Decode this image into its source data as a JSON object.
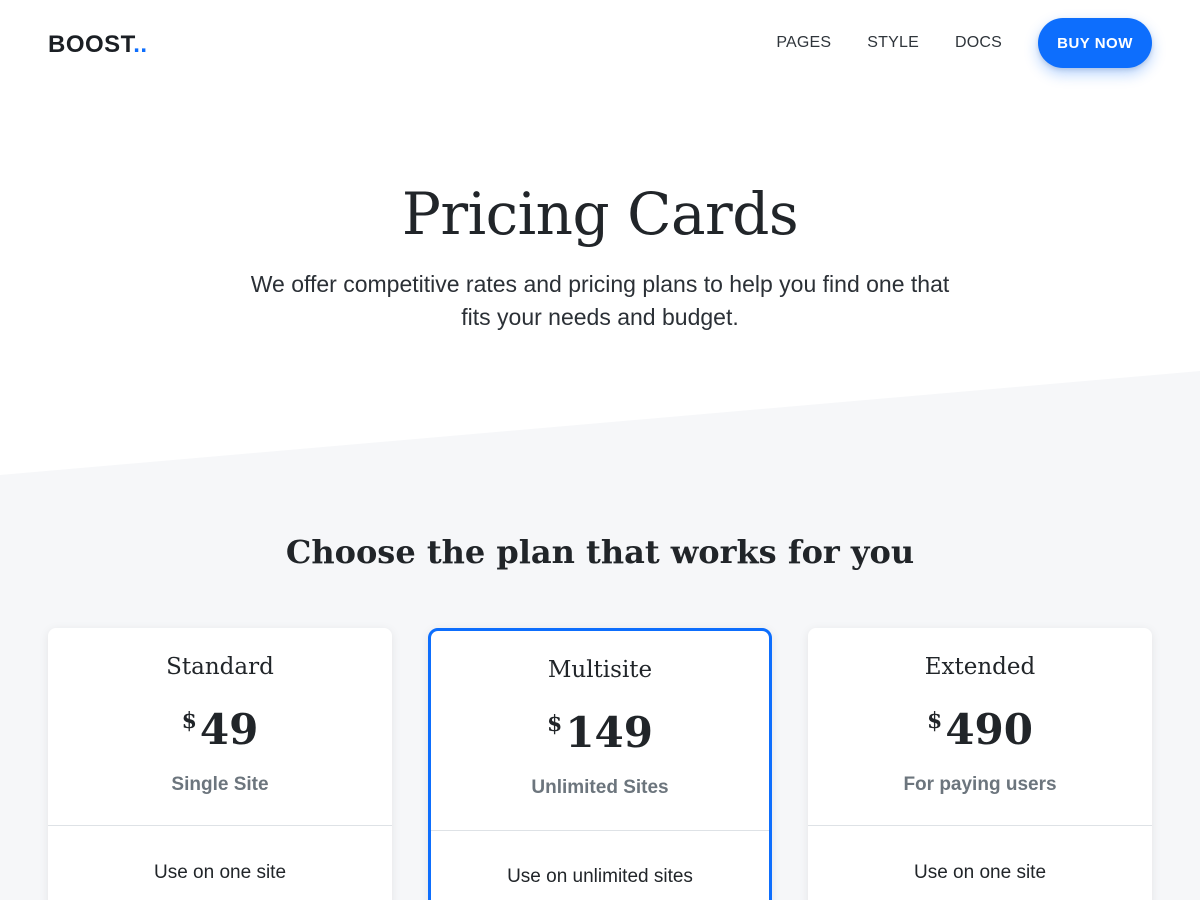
{
  "header": {
    "logo": "BOOST",
    "logo_dots": "..",
    "nav": [
      "PAGES",
      "STYLE",
      "DOCS"
    ],
    "cta": "BUY NOW"
  },
  "hero": {
    "title": "Pricing Cards",
    "subtitle": "We offer competitive rates and pricing plans to help you find one that fits your needs and budget."
  },
  "plans_section": {
    "title": "Choose the plan that works for you",
    "plans": [
      {
        "name": "Standard",
        "currency": "$",
        "price": "49",
        "subtitle": "Single Site",
        "feature": "Use on one site",
        "featured": false
      },
      {
        "name": "Multisite",
        "currency": "$",
        "price": "149",
        "subtitle": "Unlimited Sites",
        "feature": "Use on unlimited sites",
        "featured": true
      },
      {
        "name": "Extended",
        "currency": "$",
        "price": "490",
        "subtitle": "For paying users",
        "feature": "Use on one site",
        "featured": false
      }
    ]
  },
  "colors": {
    "accent": "#0d6efd",
    "section_bg": "#f6f7f9",
    "muted_text": "#6c757d"
  }
}
